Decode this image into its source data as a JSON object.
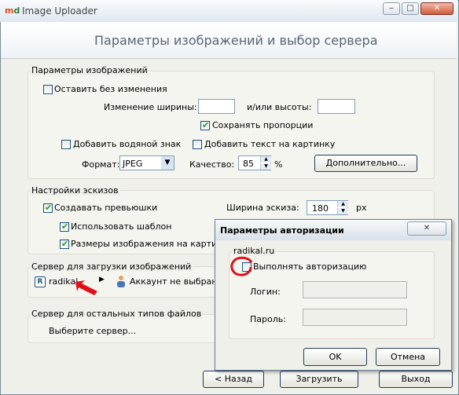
{
  "window": {
    "logo_m": "m",
    "logo_d": "d",
    "title": "Image Uploader",
    "controls": {
      "minimize": "‒",
      "maximize": "□",
      "close": "✕"
    }
  },
  "header": {
    "title": "Параметры изображений и выбор сервера"
  },
  "image_params": {
    "legend": "Параметры изображений",
    "keep_unchanged_label": "Оставить без изменения",
    "keep_unchanged_checked": false,
    "width_label": "Изменение ширины:",
    "width_value": "",
    "height_label": "и/или высоты:",
    "height_value": "",
    "keep_proportions_label": "Сохранять пропорции",
    "keep_proportions_checked": true,
    "watermark_label": "Добавить водяной знак",
    "watermark_checked": false,
    "add_text_label": "Добавить текст на картинку",
    "add_text_checked": false,
    "format_label": "Формат:",
    "format_value": "JPEG",
    "quality_label": "Качество:",
    "quality_value": "85",
    "quality_unit": "%",
    "advanced_button": "Дополнительно..."
  },
  "thumbs": {
    "legend": "Настройки эскизов",
    "create_label": "Создавать превьюшки",
    "create_checked": true,
    "template_label": "Использовать шаблон",
    "template_checked": true,
    "sizes_label": "Размеры изображения на картинке",
    "sizes_checked": true,
    "width_label": "Ширина эскиза:",
    "width_value": "180",
    "width_unit": "px"
  },
  "server": {
    "legend": "Сервер для загрузки изображений",
    "name": "radikal",
    "account": "Аккаунт не выбран"
  },
  "other_server": {
    "legend": "Сервер для остальных типов файлов",
    "select": "Выберите сервер..."
  },
  "footer": {
    "back_button": "< Назад",
    "upload_button": "Загрузить",
    "exit_button": "Выход"
  },
  "auth_dialog": {
    "title": "Параметры авторизации",
    "close": "✕",
    "group": "radikal.ru",
    "perform_auth_label": "Выполнять авторизацию",
    "perform_auth_checked": false,
    "login_label": "Логин:",
    "login_value": "",
    "password_label": "Пароль:",
    "password_value": "",
    "ok_button": "OK",
    "cancel_button": "Отмена"
  },
  "colors": {
    "annotation_red": "#e0101a",
    "accent_blue": "#1c5180"
  }
}
